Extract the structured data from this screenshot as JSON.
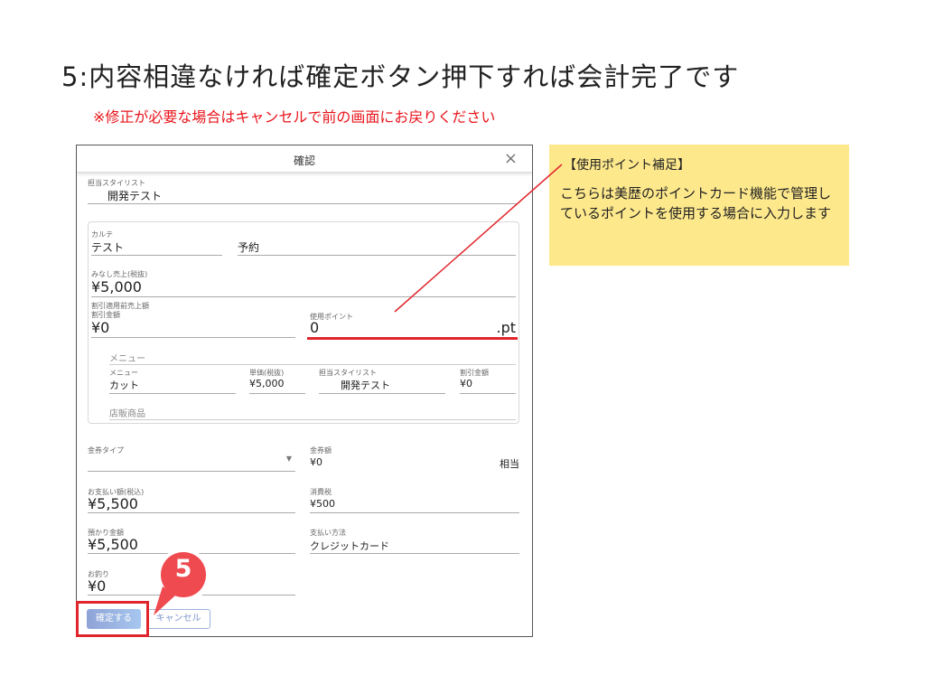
{
  "slide": {
    "title": "5:内容相違なければ確定ボタン押下すれば会計完了です",
    "note": "※修正が必要な場合はキャンセルで前の画面にお戻りください",
    "step_number": "5"
  },
  "callout": {
    "title": "【使用ポイント補足】",
    "body": "こちらは美歴のポイントカード機能で管理しているポイントを使用する場合に入力します"
  },
  "dialog": {
    "title": "確認",
    "close_icon": "×",
    "stylist": {
      "label": "担当スタイリスト",
      "value": "開発テスト"
    },
    "karte": {
      "label": "カルテ",
      "value": "テスト"
    },
    "reservation": {
      "label": "予約",
      "value": ""
    },
    "estimated_sales": {
      "label": "みなし売上(税抜)",
      "value": "¥5,000"
    },
    "pre_discount_label": "割引適用前売上額",
    "discount": {
      "label": "割引金額",
      "value": "¥0"
    },
    "points": {
      "label": "使用ポイント",
      "value": "0",
      "unit": ".pt"
    },
    "menu_section_label": "メニュー",
    "menu_table": {
      "headers": [
        "メニュー",
        "単価(税抜)",
        "担当スタイリスト",
        "割引金額"
      ],
      "rows": [
        [
          "カット",
          "¥5,000",
          "開発テスト",
          "¥0"
        ]
      ]
    },
    "retail_label": "店販商品",
    "voucher_type": {
      "label": "金券タイプ",
      "value": ""
    },
    "voucher_amount": {
      "label": "金券額",
      "value": "¥0",
      "suffix": "相当"
    },
    "payment_amount": {
      "label": "お支払い額(税込)",
      "value": "¥5,500"
    },
    "consumption_tax": {
      "label": "消費税",
      "value": "¥500"
    },
    "deposit_amount": {
      "label": "預かり金額",
      "value": "¥5,500"
    },
    "payment_method": {
      "label": "支払い方法",
      "value": "クレジットカード"
    },
    "change": {
      "label": "お釣り",
      "value": "¥0"
    },
    "confirm_button": "確定する",
    "cancel_button": "キャンセル"
  },
  "colors": {
    "accent_red": "#e0262c",
    "callout_bg": "#fde88c",
    "confirm_button": "#9bb5e3"
  }
}
